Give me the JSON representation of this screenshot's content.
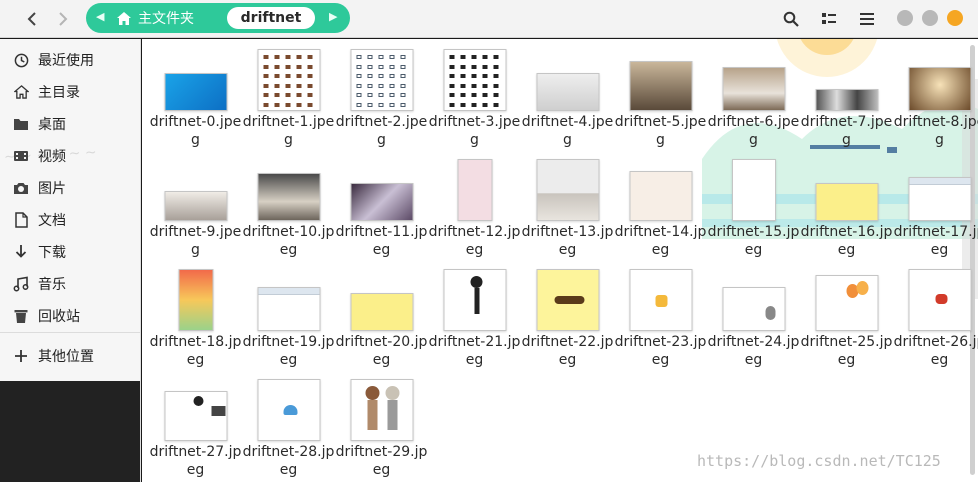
{
  "header": {
    "back_label": "‹",
    "forward_label": "›",
    "home_label": "主文件夹",
    "current_folder": "driftnet"
  },
  "sidebar": {
    "items": [
      {
        "label": "最近使用",
        "icon": "clock-icon"
      },
      {
        "label": "主目录",
        "icon": "home-icon"
      },
      {
        "label": "桌面",
        "icon": "folder-icon"
      },
      {
        "label": "视频",
        "icon": "video-icon"
      },
      {
        "label": "图片",
        "icon": "camera-icon"
      },
      {
        "label": "文档",
        "icon": "document-icon"
      },
      {
        "label": "下载",
        "icon": "download-icon"
      },
      {
        "label": "音乐",
        "icon": "music-icon"
      },
      {
        "label": "回收站",
        "icon": "trash-icon"
      },
      {
        "label": "其他位置",
        "icon": "plus-icon"
      }
    ]
  },
  "files": [
    {
      "name": "driftnet-0.jpeg",
      "thumb": "blue"
    },
    {
      "name": "driftnet-1.jpeg",
      "thumb": "grid-brown"
    },
    {
      "name": "driftnet-2.jpeg",
      "thumb": "grid-icons"
    },
    {
      "name": "driftnet-3.jpeg",
      "thumb": "grid-black"
    },
    {
      "name": "driftnet-4.jpeg",
      "thumb": "gray-wide"
    },
    {
      "name": "driftnet-5.jpeg",
      "thumb": "room-dark"
    },
    {
      "name": "driftnet-6.jpeg",
      "thumb": "bedroom"
    },
    {
      "name": "driftnet-7.jpeg",
      "thumb": "room-gray"
    },
    {
      "name": "driftnet-8.jpeg",
      "thumb": "room-warm"
    },
    {
      "name": "driftnet-9.jpeg",
      "thumb": "living-light"
    },
    {
      "name": "driftnet-10.jpeg",
      "thumb": "living-dark"
    },
    {
      "name": "driftnet-11.jpeg",
      "thumb": "purple-room"
    },
    {
      "name": "driftnet-12.jpeg",
      "thumb": "pink-tall"
    },
    {
      "name": "driftnet-13.jpeg",
      "thumb": "desk"
    },
    {
      "name": "driftnet-14.jpeg",
      "thumb": "floral"
    },
    {
      "name": "driftnet-15.jpeg",
      "thumb": "blank-tall"
    },
    {
      "name": "driftnet-16.jpeg",
      "thumb": "yellow"
    },
    {
      "name": "driftnet-17.jpeg",
      "thumb": "window"
    },
    {
      "name": "driftnet-18.jpeg",
      "thumb": "gradient"
    },
    {
      "name": "driftnet-19.jpeg",
      "thumb": "window"
    },
    {
      "name": "driftnet-20.jpeg",
      "thumb": "yellow"
    },
    {
      "name": "driftnet-21.jpeg",
      "thumb": "stick-figure"
    },
    {
      "name": "driftnet-22.jpeg",
      "thumb": "mustache"
    },
    {
      "name": "driftnet-23.jpeg",
      "thumb": "beer"
    },
    {
      "name": "driftnet-24.jpeg",
      "thumb": "totoro"
    },
    {
      "name": "driftnet-25.jpeg",
      "thumb": "balloons"
    },
    {
      "name": "driftnet-26.jpeg",
      "thumb": "superhero"
    },
    {
      "name": "driftnet-27.jpeg",
      "thumb": "collage"
    },
    {
      "name": "driftnet-28.jpeg",
      "thumb": "blue-cap"
    },
    {
      "name": "driftnet-29.jpeg",
      "thumb": "couple"
    }
  ],
  "watermark": "https://blog.csdn.net/TC125",
  "colors": {
    "pathbar": "#2ec99a",
    "window_close": "#f5a623",
    "window_other": "#b8b8b8"
  }
}
